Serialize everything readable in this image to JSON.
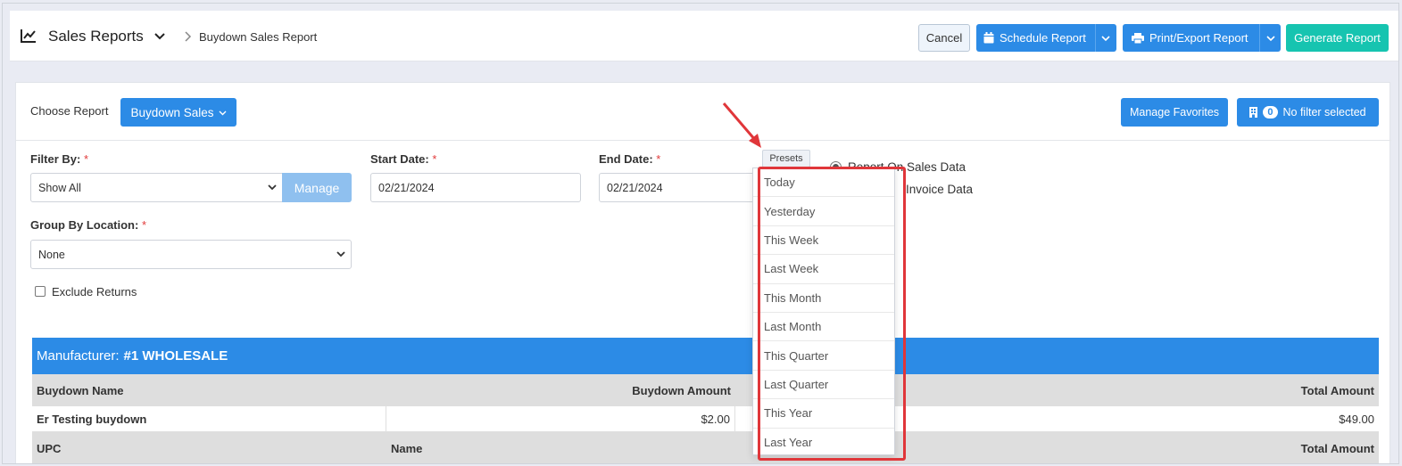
{
  "header": {
    "title": "Sales Reports",
    "breadcrumb": "Buydown Sales Report",
    "cancel_label": "Cancel",
    "schedule_label": "Schedule Report",
    "print_label": "Print/Export Report",
    "generate_label": "Generate Report"
  },
  "report": {
    "choose_label": "Choose Report",
    "selected_report": "Buydown Sales",
    "manage_favorites_label": "Manage Favorites",
    "filter_count": "0",
    "filter_status": "No filter selected"
  },
  "form": {
    "filter_by_label": "Filter By:",
    "filter_by_value": "Show All",
    "manage_label": "Manage",
    "start_date_label": "Start Date:",
    "start_date_value": "02/21/2024",
    "end_date_label": "End Date:",
    "end_date_value": "02/21/2024",
    "presets_label": "Presets",
    "radio_sales": "Report On Sales Data",
    "radio_invoice": "Invoice Data",
    "group_by_label": "Group By Location:",
    "group_by_value": "None",
    "exclude_returns_label": "Exclude Returns",
    "required_mark": "*"
  },
  "presets": {
    "items": [
      "Today",
      "Yesterday",
      "This Week",
      "Last Week",
      "This Month",
      "Last Month",
      "This Quarter",
      "Last Quarter",
      "This Year",
      "Last Year"
    ]
  },
  "table": {
    "manufacturer_prefix": "Manufacturer:",
    "manufacturer_name": "#1 WHOLESALE",
    "header1": {
      "buydown_name": "Buydown Name",
      "buydown_amount": "Buydown Amount",
      "total_amount": "Total Amount"
    },
    "row1": {
      "name": "Er Testing buydown",
      "amount": "$2.00",
      "total": "$49.00"
    },
    "header2": {
      "upc": "UPC",
      "name": "Name",
      "total_amount": "Total Amount"
    }
  },
  "colors": {
    "primary": "#2c8be6",
    "teal": "#16c4b0",
    "highlight": "#e0363a"
  }
}
